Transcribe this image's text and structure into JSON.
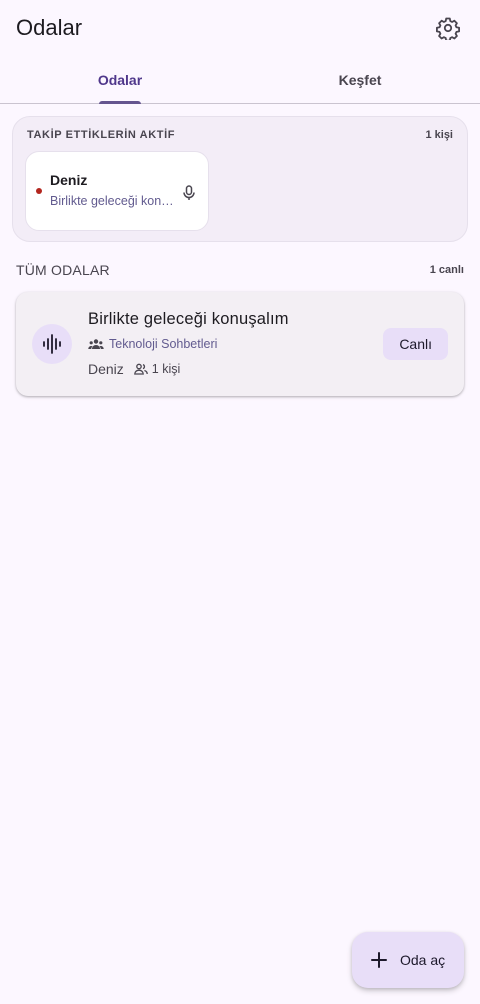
{
  "appbar": {
    "title": "Odalar",
    "settings_icon": "gear-icon"
  },
  "tabs": [
    {
      "label": "Odalar",
      "active": true
    },
    {
      "label": "Keşfet",
      "active": false
    }
  ],
  "following": {
    "title": "TAKİP ETTİKLERİN AKTİF",
    "count": "1 kişi",
    "users": [
      {
        "name": "Deniz",
        "room": "Birlikte geleceği konuşalım",
        "status_color": "#b3261e",
        "icon": "mic-icon"
      }
    ]
  },
  "all_rooms": {
    "title": "TÜM ODALAR",
    "count": "1 canlı",
    "rooms": [
      {
        "title": "Birlikte geleceği konuşalım",
        "topic": "Teknoloji Sohbetleri",
        "host": "Deniz",
        "participants": "1 kişi",
        "status": "Canlı",
        "icon": "audio-waveform-icon"
      }
    ]
  },
  "fab": {
    "label": "Oda aç",
    "icon": "plus-icon"
  },
  "colors": {
    "background": "#fcf7ff",
    "accent": "#65558f",
    "tonal": "#e8def8",
    "live": "#b3261e"
  }
}
